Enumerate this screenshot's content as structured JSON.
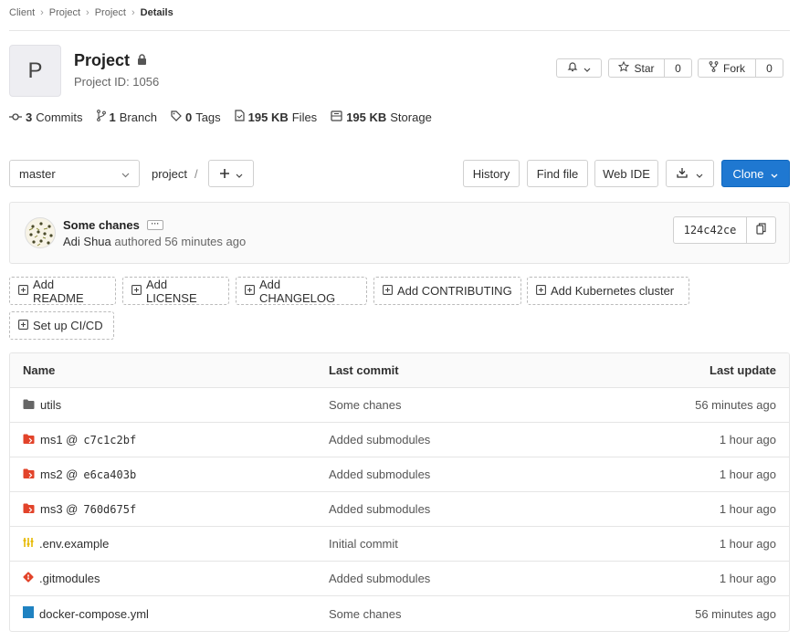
{
  "breadcrumb": {
    "items": [
      "Client",
      "Project",
      "Project"
    ],
    "current": "Details"
  },
  "project": {
    "avatar_letter": "P",
    "name": "Project",
    "id_label": "Project ID: 1056"
  },
  "actions": {
    "star_label": "Star",
    "star_count": "0",
    "fork_label": "Fork",
    "fork_count": "0"
  },
  "stats": {
    "commits_count": "3",
    "commits_label": "Commits",
    "branch_count": "1",
    "branch_label": "Branch",
    "tags_count": "0",
    "tags_label": "Tags",
    "files_size": "195 KB",
    "files_label": "Files",
    "storage_size": "195 KB",
    "storage_label": "Storage"
  },
  "toolbar": {
    "branch": "master",
    "path": "project",
    "path_sep": "/",
    "history": "History",
    "find_file": "Find file",
    "web_ide": "Web IDE",
    "clone": "Clone"
  },
  "commit": {
    "title": "Some chanes",
    "more": "···",
    "author": "Adi Shua",
    "meta": "authored 56 minutes ago",
    "sha": "124c42ce"
  },
  "add_buttons": [
    "Add README",
    "Add LICENSE",
    "Add CHANGELOG",
    "Add CONTRIBUTING",
    "Add Kubernetes cluster",
    "Set up CI/CD"
  ],
  "table": {
    "headers": {
      "name": "Name",
      "last_commit": "Last commit",
      "last_update": "Last update"
    },
    "rows": [
      {
        "icon": "folder-icon",
        "name": "utils",
        "hash": "",
        "commit": "Some chanes",
        "update": "56 minutes ago"
      },
      {
        "icon": "submodule-icon",
        "name": "ms1 @",
        "hash": "c7c1c2bf",
        "commit": "Added submodules",
        "update": "1 hour ago"
      },
      {
        "icon": "submodule-icon",
        "name": "ms2 @",
        "hash": "e6ca403b",
        "commit": "Added submodules",
        "update": "1 hour ago"
      },
      {
        "icon": "submodule-icon",
        "name": "ms3 @",
        "hash": "760d675f",
        "commit": "Added submodules",
        "update": "1 hour ago"
      },
      {
        "icon": "env-file-icon",
        "name": ".env.example",
        "hash": "",
        "commit": "Initial commit",
        "update": "1 hour ago"
      },
      {
        "icon": "git-icon",
        "name": ".gitmodules",
        "hash": "",
        "commit": "Added submodules",
        "update": "1 hour ago"
      },
      {
        "icon": "docker-file-icon",
        "name": "docker-compose.yml",
        "hash": "",
        "commit": "Some chanes",
        "update": "56 minutes ago"
      }
    ]
  },
  "colors": {
    "accent": "#1f78d1",
    "submodule": "#e2432a",
    "git": "#e24329",
    "env": "#e6b800",
    "docker": "#1f82c1"
  }
}
